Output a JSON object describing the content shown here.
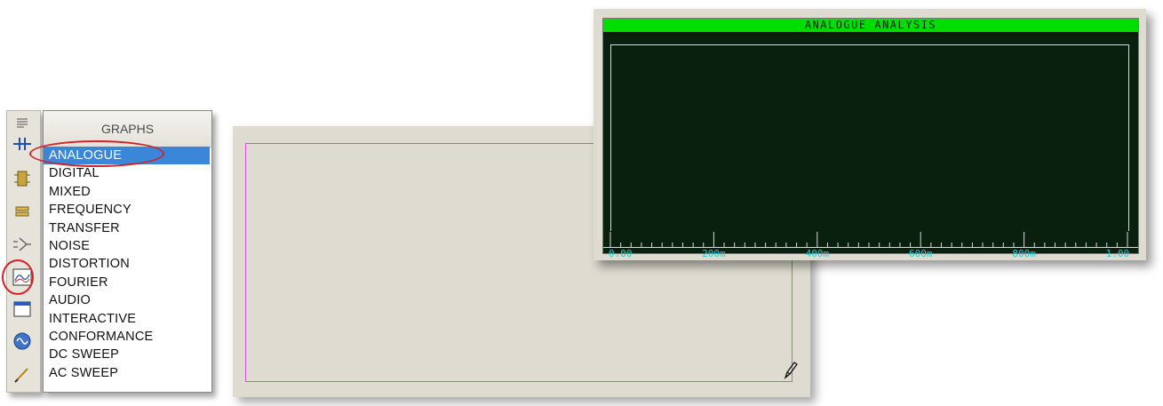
{
  "toolbar": {
    "tools": [
      {
        "name": "selection-mode-icon",
        "glyph": "lines"
      },
      {
        "name": "component-mode-icon",
        "glyph": "component"
      },
      {
        "name": "junction-dot-icon",
        "glyph": "chip"
      },
      {
        "name": "wire-label-icon",
        "glyph": "label"
      },
      {
        "name": "terminal-icon",
        "glyph": "terminal"
      },
      {
        "name": "graph-mode-icon",
        "glyph": "graph"
      },
      {
        "name": "tape-recorder-icon",
        "glyph": "window"
      },
      {
        "name": "generator-mode-icon",
        "glyph": "sine"
      },
      {
        "name": "voltage-probe-icon",
        "glyph": "probe"
      }
    ],
    "highlight_color": "#d41f24"
  },
  "graphs_panel": {
    "title": "GRAPHS",
    "items": [
      {
        "label": "ANALOGUE",
        "selected": true
      },
      {
        "label": "DIGITAL"
      },
      {
        "label": "MIXED"
      },
      {
        "label": "FREQUENCY"
      },
      {
        "label": "TRANSFER"
      },
      {
        "label": "NOISE"
      },
      {
        "label": "DISTORTION"
      },
      {
        "label": "FOURIER"
      },
      {
        "label": "AUDIO"
      },
      {
        "label": "INTERACTIVE"
      },
      {
        "label": "CONFORMANCE"
      },
      {
        "label": "DC SWEEP"
      },
      {
        "label": "AC SWEEP"
      }
    ],
    "selection_color": "#3a86d8"
  },
  "canvas": {
    "background": "#dedcd0",
    "drag_rect_color": "#d94ddf",
    "cursor_icon": "pencil-icon"
  },
  "analogue_graph": {
    "title": "ANALOGUE ANALYSIS",
    "title_bar_color": "#00dd00",
    "plot_background": "#0a200e",
    "tick_color": "#29c6d4",
    "x_ticks": [
      "0.00",
      "200m",
      "400m",
      "600m",
      "800m",
      "1.00"
    ],
    "x_range": [
      0,
      1
    ]
  }
}
